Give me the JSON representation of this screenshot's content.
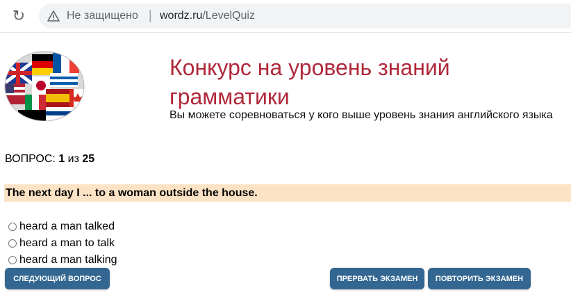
{
  "browser": {
    "security_label": "Не защищено",
    "separator": "|",
    "url_domain": "wordz.ru",
    "url_path": "/LevelQuiz"
  },
  "page": {
    "title": "Конкурс на уровень знаний грамматики",
    "subtitle": "Вы можете соревноваться у кого выше уровень знания английского языка"
  },
  "quiz": {
    "counter_label": "ВОПРОС:",
    "current": "1",
    "of_label": "из",
    "total": "25",
    "question": "The next day I ... to a woman outside the house.",
    "options": [
      {
        "label": "heard a man talked"
      },
      {
        "label": "heard a man to talk"
      },
      {
        "label": "heard a man talking"
      }
    ]
  },
  "buttons": {
    "next": "СЛЕДУЮЩИЙ ВОПРОС",
    "stop": "ПРЕРВАТЬ ЭКЗАМЕН",
    "repeat": "ПОВТОРИТЬ ЭКЗАМЕН"
  },
  "colors": {
    "title": "#b0283a",
    "question_bg": "#fde3c5",
    "button_bg": "#336791"
  }
}
